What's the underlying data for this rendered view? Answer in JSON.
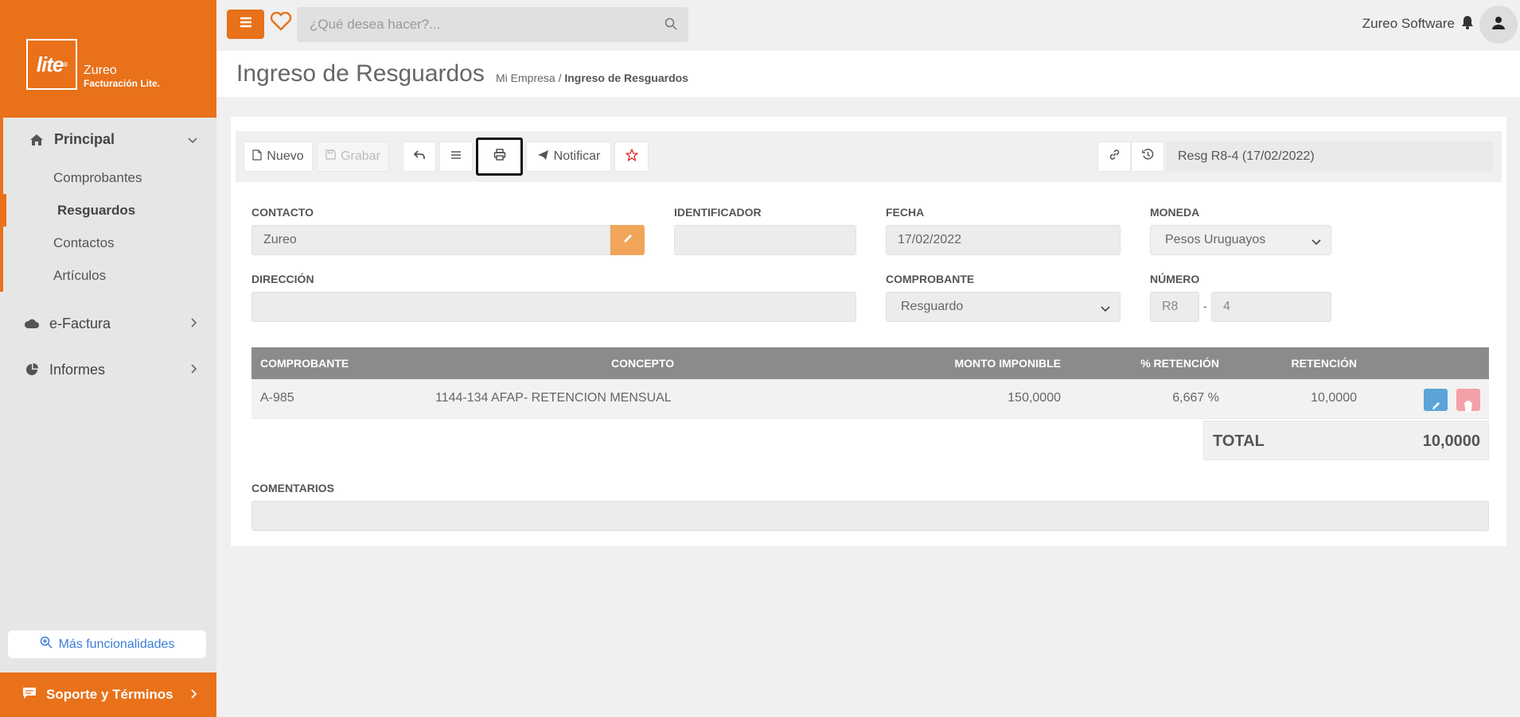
{
  "brand": {
    "logo_text": "lite",
    "name": "Zureo",
    "subtitle": "Facturación Lite."
  },
  "sidebar": {
    "groups": [
      {
        "label": "Principal",
        "icon": "home-icon",
        "expanded": true,
        "items": [
          {
            "label": "Comprobantes"
          },
          {
            "label": "Resguardos",
            "active": true
          },
          {
            "label": "Contactos"
          },
          {
            "label": "Artículos"
          }
        ]
      },
      {
        "label": "e-Factura",
        "icon": "cloud-icon"
      },
      {
        "label": "Informes",
        "icon": "pie-chart-icon"
      }
    ],
    "more_label": "Más funcionalidades",
    "support_label": "Soporte y Términos"
  },
  "topbar": {
    "search_placeholder": "¿Qué desea hacer?...",
    "user_name": "Zureo Software"
  },
  "page": {
    "title": "Ingreso de Resguardos",
    "breadcrumb_root": "Mi Empresa",
    "breadcrumb_sep": "/",
    "breadcrumb_current": "Ingreso de Resguardos"
  },
  "toolbar": {
    "new_label": "Nuevo",
    "save_label": "Grabar",
    "notify_label": "Notificar",
    "doc_ref": "Resg R8-4 (17/02/2022)"
  },
  "form": {
    "contacto_label": "CONTACTO",
    "contacto_value": "Zureo",
    "identificador_label": "IDENTIFICADOR",
    "identificador_value": "",
    "fecha_label": "FECHA",
    "fecha_value": "17/02/2022",
    "moneda_label": "MONEDA",
    "moneda_value": "Pesos Uruguayos",
    "direccion_label": "DIRECCIÓN",
    "direccion_value": "",
    "comprobante_label": "COMPROBANTE",
    "comprobante_value": "Resguardo",
    "numero_label": "NÚMERO",
    "numero_serie": "R8",
    "numero_sep": "-",
    "numero_value": "4",
    "comentarios_label": "COMENTARIOS",
    "comentarios_value": ""
  },
  "table": {
    "headers": [
      "COMPROBANTE",
      "CONCEPTO",
      "MONTO IMPONIBLE",
      "% RETENCIÓN",
      "RETENCIÓN"
    ],
    "rows": [
      {
        "comprobante": "A-985",
        "concepto": "1144-134 AFAP- RETENCION MENSUAL",
        "monto": "150,0000",
        "porcentaje": "6,667 %",
        "retencion": "10,0000"
      }
    ],
    "total_label": "TOTAL",
    "total_value": "10,0000"
  },
  "colors": {
    "accent": "#e8711a",
    "edit_blue": "#5ba4d8",
    "delete_pink": "#f4a0a8"
  }
}
